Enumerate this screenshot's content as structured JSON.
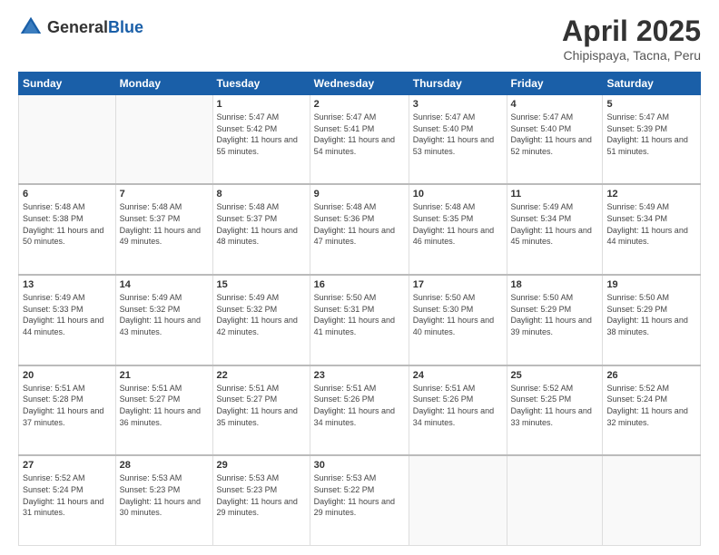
{
  "header": {
    "logo_general": "General",
    "logo_blue": "Blue",
    "title": "April 2025",
    "location": "Chipispaya, Tacna, Peru"
  },
  "weekdays": [
    "Sunday",
    "Monday",
    "Tuesday",
    "Wednesday",
    "Thursday",
    "Friday",
    "Saturday"
  ],
  "weeks": [
    [
      {
        "day": "",
        "sunrise": "",
        "sunset": "",
        "daylight": ""
      },
      {
        "day": "",
        "sunrise": "",
        "sunset": "",
        "daylight": ""
      },
      {
        "day": "1",
        "sunrise": "Sunrise: 5:47 AM",
        "sunset": "Sunset: 5:42 PM",
        "daylight": "Daylight: 11 hours and 55 minutes."
      },
      {
        "day": "2",
        "sunrise": "Sunrise: 5:47 AM",
        "sunset": "Sunset: 5:41 PM",
        "daylight": "Daylight: 11 hours and 54 minutes."
      },
      {
        "day": "3",
        "sunrise": "Sunrise: 5:47 AM",
        "sunset": "Sunset: 5:40 PM",
        "daylight": "Daylight: 11 hours and 53 minutes."
      },
      {
        "day": "4",
        "sunrise": "Sunrise: 5:47 AM",
        "sunset": "Sunset: 5:40 PM",
        "daylight": "Daylight: 11 hours and 52 minutes."
      },
      {
        "day": "5",
        "sunrise": "Sunrise: 5:47 AM",
        "sunset": "Sunset: 5:39 PM",
        "daylight": "Daylight: 11 hours and 51 minutes."
      }
    ],
    [
      {
        "day": "6",
        "sunrise": "Sunrise: 5:48 AM",
        "sunset": "Sunset: 5:38 PM",
        "daylight": "Daylight: 11 hours and 50 minutes."
      },
      {
        "day": "7",
        "sunrise": "Sunrise: 5:48 AM",
        "sunset": "Sunset: 5:37 PM",
        "daylight": "Daylight: 11 hours and 49 minutes."
      },
      {
        "day": "8",
        "sunrise": "Sunrise: 5:48 AM",
        "sunset": "Sunset: 5:37 PM",
        "daylight": "Daylight: 11 hours and 48 minutes."
      },
      {
        "day": "9",
        "sunrise": "Sunrise: 5:48 AM",
        "sunset": "Sunset: 5:36 PM",
        "daylight": "Daylight: 11 hours and 47 minutes."
      },
      {
        "day": "10",
        "sunrise": "Sunrise: 5:48 AM",
        "sunset": "Sunset: 5:35 PM",
        "daylight": "Daylight: 11 hours and 46 minutes."
      },
      {
        "day": "11",
        "sunrise": "Sunrise: 5:49 AM",
        "sunset": "Sunset: 5:34 PM",
        "daylight": "Daylight: 11 hours and 45 minutes."
      },
      {
        "day": "12",
        "sunrise": "Sunrise: 5:49 AM",
        "sunset": "Sunset: 5:34 PM",
        "daylight": "Daylight: 11 hours and 44 minutes."
      }
    ],
    [
      {
        "day": "13",
        "sunrise": "Sunrise: 5:49 AM",
        "sunset": "Sunset: 5:33 PM",
        "daylight": "Daylight: 11 hours and 44 minutes."
      },
      {
        "day": "14",
        "sunrise": "Sunrise: 5:49 AM",
        "sunset": "Sunset: 5:32 PM",
        "daylight": "Daylight: 11 hours and 43 minutes."
      },
      {
        "day": "15",
        "sunrise": "Sunrise: 5:49 AM",
        "sunset": "Sunset: 5:32 PM",
        "daylight": "Daylight: 11 hours and 42 minutes."
      },
      {
        "day": "16",
        "sunrise": "Sunrise: 5:50 AM",
        "sunset": "Sunset: 5:31 PM",
        "daylight": "Daylight: 11 hours and 41 minutes."
      },
      {
        "day": "17",
        "sunrise": "Sunrise: 5:50 AM",
        "sunset": "Sunset: 5:30 PM",
        "daylight": "Daylight: 11 hours and 40 minutes."
      },
      {
        "day": "18",
        "sunrise": "Sunrise: 5:50 AM",
        "sunset": "Sunset: 5:29 PM",
        "daylight": "Daylight: 11 hours and 39 minutes."
      },
      {
        "day": "19",
        "sunrise": "Sunrise: 5:50 AM",
        "sunset": "Sunset: 5:29 PM",
        "daylight": "Daylight: 11 hours and 38 minutes."
      }
    ],
    [
      {
        "day": "20",
        "sunrise": "Sunrise: 5:51 AM",
        "sunset": "Sunset: 5:28 PM",
        "daylight": "Daylight: 11 hours and 37 minutes."
      },
      {
        "day": "21",
        "sunrise": "Sunrise: 5:51 AM",
        "sunset": "Sunset: 5:27 PM",
        "daylight": "Daylight: 11 hours and 36 minutes."
      },
      {
        "day": "22",
        "sunrise": "Sunrise: 5:51 AM",
        "sunset": "Sunset: 5:27 PM",
        "daylight": "Daylight: 11 hours and 35 minutes."
      },
      {
        "day": "23",
        "sunrise": "Sunrise: 5:51 AM",
        "sunset": "Sunset: 5:26 PM",
        "daylight": "Daylight: 11 hours and 34 minutes."
      },
      {
        "day": "24",
        "sunrise": "Sunrise: 5:51 AM",
        "sunset": "Sunset: 5:26 PM",
        "daylight": "Daylight: 11 hours and 34 minutes."
      },
      {
        "day": "25",
        "sunrise": "Sunrise: 5:52 AM",
        "sunset": "Sunset: 5:25 PM",
        "daylight": "Daylight: 11 hours and 33 minutes."
      },
      {
        "day": "26",
        "sunrise": "Sunrise: 5:52 AM",
        "sunset": "Sunset: 5:24 PM",
        "daylight": "Daylight: 11 hours and 32 minutes."
      }
    ],
    [
      {
        "day": "27",
        "sunrise": "Sunrise: 5:52 AM",
        "sunset": "Sunset: 5:24 PM",
        "daylight": "Daylight: 11 hours and 31 minutes."
      },
      {
        "day": "28",
        "sunrise": "Sunrise: 5:53 AM",
        "sunset": "Sunset: 5:23 PM",
        "daylight": "Daylight: 11 hours and 30 minutes."
      },
      {
        "day": "29",
        "sunrise": "Sunrise: 5:53 AM",
        "sunset": "Sunset: 5:23 PM",
        "daylight": "Daylight: 11 hours and 29 minutes."
      },
      {
        "day": "30",
        "sunrise": "Sunrise: 5:53 AM",
        "sunset": "Sunset: 5:22 PM",
        "daylight": "Daylight: 11 hours and 29 minutes."
      },
      {
        "day": "",
        "sunrise": "",
        "sunset": "",
        "daylight": ""
      },
      {
        "day": "",
        "sunrise": "",
        "sunset": "",
        "daylight": ""
      },
      {
        "day": "",
        "sunrise": "",
        "sunset": "",
        "daylight": ""
      }
    ]
  ]
}
